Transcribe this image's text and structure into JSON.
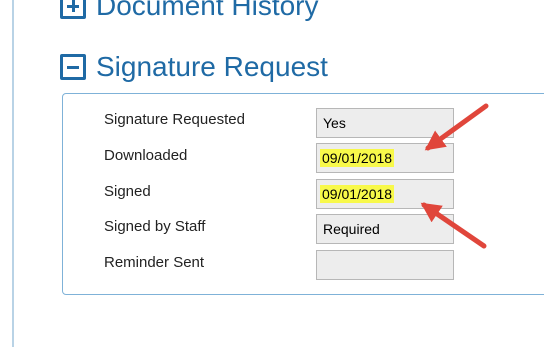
{
  "sections": {
    "document_history": {
      "title": "Document History",
      "state": "collapsed"
    },
    "signature_request": {
      "title": "Signature Request",
      "state": "expanded"
    }
  },
  "signature_request": {
    "fields": {
      "signature_requested": {
        "label": "Signature Requested",
        "value": "Yes"
      },
      "downloaded": {
        "label": "Downloaded",
        "value": "09/01/2018",
        "highlighted": true
      },
      "signed": {
        "label": "Signed",
        "value": "09/01/2018",
        "highlighted": true
      },
      "signed_by_staff": {
        "label": "Signed by Staff",
        "value": "Required"
      },
      "reminder_sent": {
        "label": "Reminder Sent",
        "value": ""
      }
    }
  },
  "colors": {
    "accent": "#1f6aa5",
    "panel_border": "#7fb2d8",
    "highlight": "#f8f94a",
    "annotation_arrow": "#e0463b",
    "field_background": "#ededed"
  }
}
